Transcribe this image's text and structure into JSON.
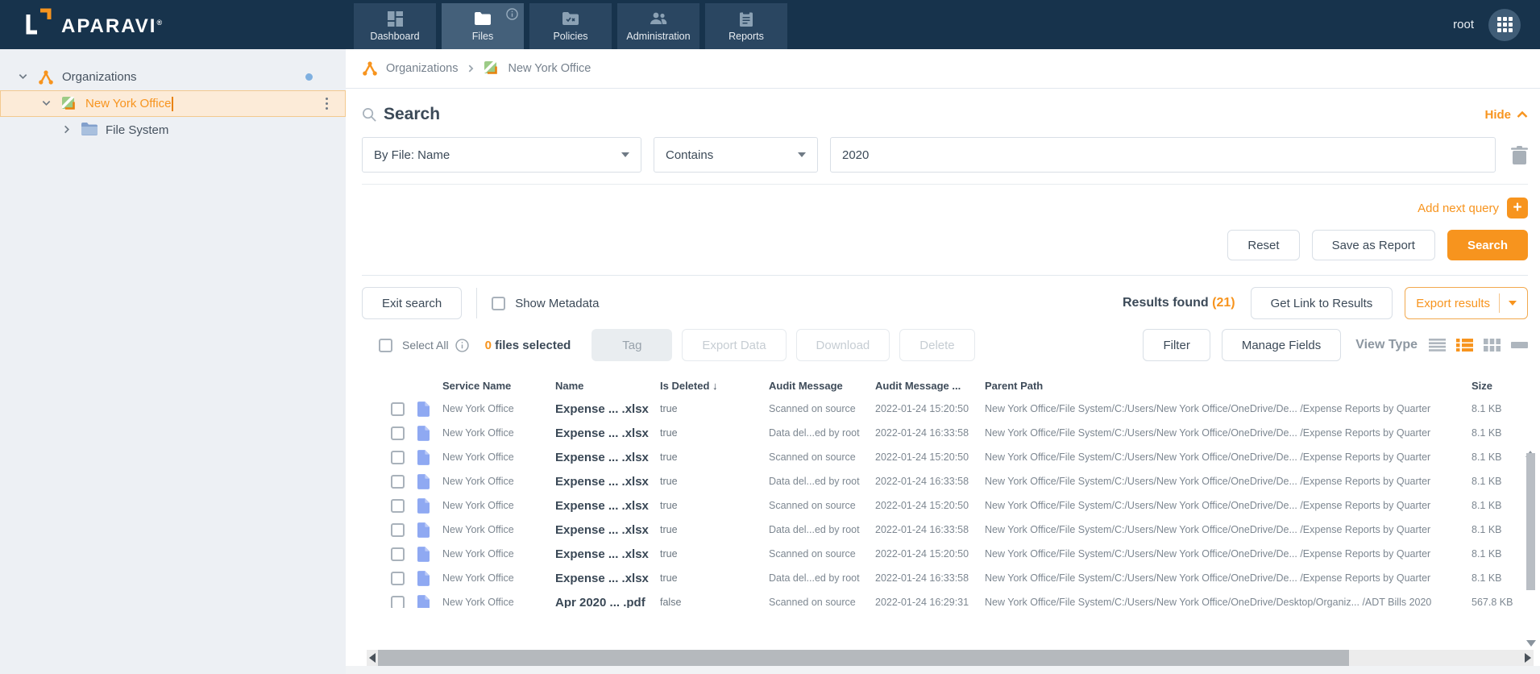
{
  "navbar": {
    "brand": "APARAVI",
    "registered_mark": "®",
    "tabs": [
      {
        "label": "Dashboard"
      },
      {
        "label": "Files"
      },
      {
        "label": "Policies"
      },
      {
        "label": "Administration"
      },
      {
        "label": "Reports"
      }
    ],
    "user_label": "root"
  },
  "sidebar": {
    "organizations_label": "Organizations",
    "new_york_office_label": "New York Office",
    "file_system_label": "File System"
  },
  "breadcrumb": {
    "organizations_label": "Organizations",
    "current_label": "New York Office"
  },
  "search_panel": {
    "title": "Search",
    "hide_label": "Hide",
    "field_dropdown_value": "By File: Name",
    "operator_dropdown_value": "Contains",
    "query_input_value": "2020",
    "add_next_query_label": "Add next query",
    "add_next_query_plus": "+",
    "reset_button": "Reset",
    "save_as_report_button": "Save as Report",
    "search_button": "Search"
  },
  "results_bar": {
    "exit_search_button": "Exit search",
    "show_metadata_label": "Show Metadata",
    "results_found_label": "Results found",
    "results_count": "(21)",
    "get_link_button": "Get Link to Results",
    "export_results_button": "Export results"
  },
  "selection_bar": {
    "select_all_label": "Select All",
    "selected_count": "0",
    "selected_suffix": " files selected",
    "tag_button": "Tag",
    "export_data_button": "Export Data",
    "download_button": "Download",
    "delete_button": "Delete",
    "filter_button": "Filter",
    "manage_fields_button": "Manage Fields",
    "view_type_label": "View Type"
  },
  "table": {
    "headers": {
      "service": "Service Name",
      "name": "Name",
      "deleted": "Is Deleted",
      "audit": "Audit Message",
      "audit_time": "Audit Message ...",
      "path": "Parent Path",
      "size": "Size"
    },
    "sort": {
      "column": "Is Deleted",
      "direction": "descending",
      "arrow": "↓"
    },
    "rows": [
      {
        "service": "New York Office",
        "name": "Expense ... .xlsx",
        "deleted": "true",
        "audit": "Scanned on source",
        "audit_time": "2022-01-24 15:20:50",
        "path": "New York Office/File System/C:/Users/New York Office/OneDrive/De... /Expense Reports by Quarter",
        "size": "8.1 KB"
      },
      {
        "service": "New York Office",
        "name": "Expense ... .xlsx",
        "deleted": "true",
        "audit": "Data del...ed by root",
        "audit_time": "2022-01-24 16:33:58",
        "path": "New York Office/File System/C:/Users/New York Office/OneDrive/De... /Expense Reports by Quarter",
        "size": "8.1 KB"
      },
      {
        "service": "New York Office",
        "name": "Expense ... .xlsx",
        "deleted": "true",
        "audit": "Scanned on source",
        "audit_time": "2022-01-24 15:20:50",
        "path": "New York Office/File System/C:/Users/New York Office/OneDrive/De... /Expense Reports by Quarter",
        "size": "8.1 KB"
      },
      {
        "service": "New York Office",
        "name": "Expense ... .xlsx",
        "deleted": "true",
        "audit": "Data del...ed by root",
        "audit_time": "2022-01-24 16:33:58",
        "path": "New York Office/File System/C:/Users/New York Office/OneDrive/De... /Expense Reports by Quarter",
        "size": "8.1 KB"
      },
      {
        "service": "New York Office",
        "name": "Expense ... .xlsx",
        "deleted": "true",
        "audit": "Scanned on source",
        "audit_time": "2022-01-24 15:20:50",
        "path": "New York Office/File System/C:/Users/New York Office/OneDrive/De... /Expense Reports by Quarter",
        "size": "8.1 KB"
      },
      {
        "service": "New York Office",
        "name": "Expense ... .xlsx",
        "deleted": "true",
        "audit": "Data del...ed by root",
        "audit_time": "2022-01-24 16:33:58",
        "path": "New York Office/File System/C:/Users/New York Office/OneDrive/De... /Expense Reports by Quarter",
        "size": "8.1 KB"
      },
      {
        "service": "New York Office",
        "name": "Expense ... .xlsx",
        "deleted": "true",
        "audit": "Scanned on source",
        "audit_time": "2022-01-24 15:20:50",
        "path": "New York Office/File System/C:/Users/New York Office/OneDrive/De... /Expense Reports by Quarter",
        "size": "8.1 KB"
      },
      {
        "service": "New York Office",
        "name": "Expense ... .xlsx",
        "deleted": "true",
        "audit": "Data del...ed by root",
        "audit_time": "2022-01-24 16:33:58",
        "path": "New York Office/File System/C:/Users/New York Office/OneDrive/De... /Expense Reports by Quarter",
        "size": "8.1 KB"
      },
      {
        "service": "New York Office",
        "name": "Apr 2020 ... .pdf",
        "deleted": "false",
        "audit": "Scanned on source",
        "audit_time": "2022-01-24 16:29:31",
        "path": "New York Office/File System/C:/Users/New York Office/OneDrive/Desktop/Organiz... /ADT Bills 2020",
        "size": "567.8 KB"
      }
    ]
  },
  "colors": {
    "accent_orange": "#F7941E",
    "navbar_bg": "#17334C",
    "selected_row_bg": "#FCEBD8",
    "file_icon_blue": "#8FA9F2",
    "status_dot_blue": "#7FB0E0"
  }
}
